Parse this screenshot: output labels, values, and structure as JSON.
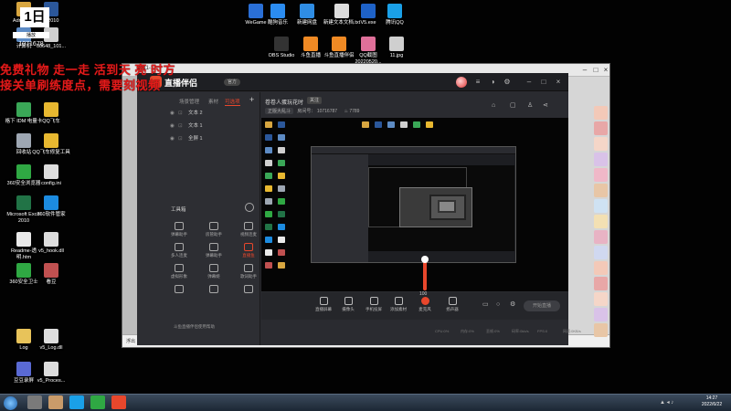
{
  "desktop": {
    "icons": [
      {
        "id": "admin",
        "label": "Adminis...",
        "color": "#d8a640"
      },
      {
        "id": "word",
        "label": "...2010",
        "color": "#2b579a"
      },
      {
        "id": "wegame",
        "label": "WeGame",
        "color": "#2a6fd6"
      },
      {
        "id": "kugou",
        "label": "酷狗音乐",
        "color": "#2b8cf0"
      },
      {
        "id": "newfolder",
        "label": "新建网盘",
        "color": "#2f8de4"
      },
      {
        "id": "newtxt",
        "label": "新建文本文档.txt",
        "color": "#dddddd"
      },
      {
        "id": "v5",
        "label": "V5.exe",
        "color": "#1e62c7"
      },
      {
        "id": "qq",
        "label": "腾讯QQ",
        "color": "#1aa0e8"
      },
      {
        "id": "computer",
        "label": "计算机",
        "color": "#5d8bc4"
      },
      {
        "id": "file00",
        "label": "00648_101...",
        "color": "#cfcfcf"
      },
      {
        "id": "obs",
        "label": "OBS Studio",
        "color": "#333333"
      },
      {
        "id": "douyu",
        "label": "斗鱼直播",
        "color": "#f08a24"
      },
      {
        "id": "douyu-tool",
        "label": "斗鱼直播伴侣",
        "color": "#f08a24"
      },
      {
        "id": "shot",
        "label": "QQ截图20220520...",
        "color": "#e0709a"
      },
      {
        "id": "jpg",
        "label": "11.jpg",
        "color": "#cfcfcf"
      },
      {
        "id": "idm",
        "label": "格下 IDM 电量卡",
        "color": "#3aa757"
      },
      {
        "id": "qqcar",
        "label": "QQ飞车",
        "color": "#e8b830"
      },
      {
        "id": "recycle",
        "label": "回收站",
        "color": "#9ea7b3"
      },
      {
        "id": "qqcar-tool",
        "label": "QQ飞车修复工具",
        "color": "#e8b830"
      },
      {
        "id": "b360",
        "label": "360安全浏览器",
        "color": "#2fa843"
      },
      {
        "id": "config",
        "label": "config.ini",
        "color": "#dddddd"
      },
      {
        "id": "excel",
        "label": "Microsoft Excel 2010",
        "color": "#217346"
      },
      {
        "id": "soft360",
        "label": "360软件管家",
        "color": "#1c8be0"
      },
      {
        "id": "readme",
        "label": "Readme-透明.htm",
        "color": "#e9e9e9"
      },
      {
        "id": "v5hook",
        "label": "v5_hook.dll",
        "color": "#dddddd"
      },
      {
        "id": "guard360",
        "label": "360安全卫士",
        "color": "#2fa843"
      },
      {
        "id": "vision",
        "label": "看豆",
        "color": "#c05050"
      },
      {
        "id": "log",
        "label": "Log",
        "color": "#e8c35a"
      },
      {
        "id": "v5log",
        "label": "v5_Log.dll",
        "color": "#dddddd"
      },
      {
        "id": "steam",
        "label": "豆豆录屏",
        "color": "#5a6ad4"
      },
      {
        "id": "v5proc",
        "label": "v5_Proces...",
        "color": "#dddddd"
      }
    ],
    "logo_badge": "1日",
    "logo_sub": "播放",
    "logo_num": "1071678",
    "overlay_line1": "免费礼物 走一走 活到天 亮 时方",
    "overlay_line2": "接关单刷练度点，需要刻视频"
  },
  "outer_window": {
    "title": "2011-1",
    "bottom_label": "浮出"
  },
  "app": {
    "brand": "直播伴侣",
    "version": "官方",
    "tabs": [
      "场景管理",
      "素材",
      "可选项"
    ],
    "layers": [
      {
        "name": "文本 2"
      },
      {
        "name": "文本 1"
      },
      {
        "name": "全屏 1"
      }
    ],
    "toolbox_title": "工具箱",
    "tools": [
      {
        "label": "弹幕助手",
        "hot": false
      },
      {
        "label": "房管助手",
        "hot": false
      },
      {
        "label": "视频连麦",
        "hot": false
      },
      {
        "label": "多人连麦",
        "hot": false
      },
      {
        "label": "弹幕助手",
        "hot": false
      },
      {
        "label": "直播鱼",
        "hot": true
      },
      {
        "label": "虚拟形象",
        "hot": false
      },
      {
        "label": "弹幕姬",
        "hot": false
      },
      {
        "label": "歌词助手",
        "hot": false
      },
      {
        "label": "",
        "hot": false
      },
      {
        "label": "",
        "hot": false
      },
      {
        "label": "",
        "hot": false
      }
    ],
    "ad_text": "斗鱼直播伴侣使用帮助",
    "room_title": "卷卷人蛋玩花时",
    "fav_label": "关注",
    "meta_category": "正版大乱斗",
    "meta_room_label": "房间号：",
    "meta_room": "10716787",
    "meta_hot_label": "热度",
    "meta_hot": "7789",
    "controls": [
      {
        "label": "直播屏幕",
        "hot": false
      },
      {
        "label": "摄像头",
        "hot": false
      },
      {
        "label": "手机投屏",
        "hot": false
      },
      {
        "label": "添加素材",
        "hot": false
      },
      {
        "label": "麦克风",
        "hot": true
      },
      {
        "label": "扬声器",
        "hot": false
      }
    ],
    "volume": 100,
    "volume_label": "100",
    "start_live": "开始直播",
    "status": [
      "CPU:0%",
      "内存:0%",
      "丢帧:0%",
      "码率:0kb/s",
      "FPS:0",
      "网速:0KB/s"
    ]
  },
  "dock": {
    "avatars": [
      "#f3c9b8",
      "#e8a7a7",
      "#f5d6c8",
      "#d9c2e8",
      "#f0b8c8",
      "#e8c6a6",
      "#cfe2f3",
      "#f3e0b3",
      "#e8b3c4",
      "#d0d8f0",
      "#f3c9b8",
      "#e8a7a7",
      "#f5d6c8",
      "#d9c2e8",
      "#e8c6a6"
    ]
  },
  "taskbar": {
    "apps": [
      "#7a7a7a",
      "#c99b6a",
      "#1aa0e8",
      "#2fa843",
      "#e8472c"
    ],
    "clock_time": "14:27",
    "clock_date": "2022/6/22",
    "tray": "▲ ◂ ♪"
  }
}
